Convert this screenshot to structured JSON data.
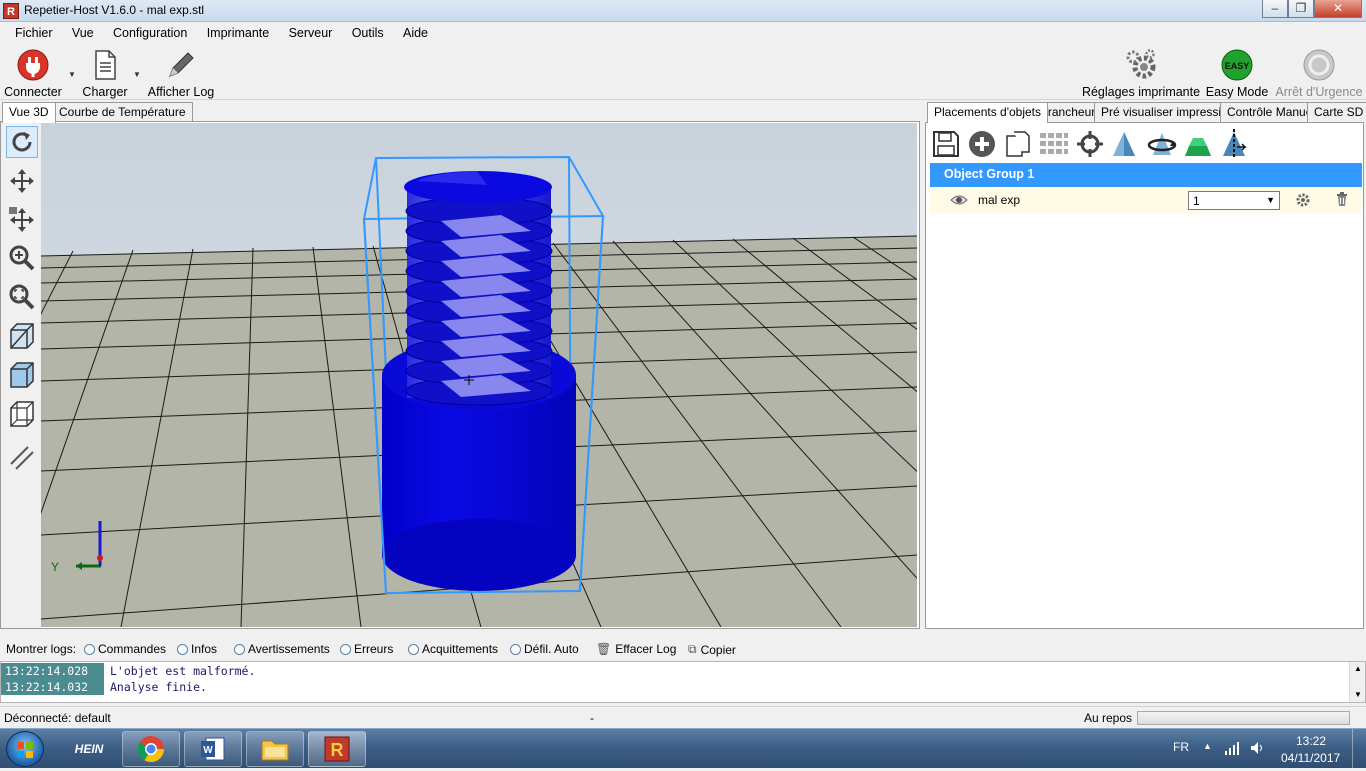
{
  "window": {
    "title": "Repetier-Host V1.6.0 - mal exp.stl",
    "app_icon": "R"
  },
  "menu": [
    "Fichier",
    "Vue",
    "Configuration",
    "Imprimante",
    "Serveur",
    "Outils",
    "Aide"
  ],
  "toolbar": {
    "connect": "Connecter",
    "load": "Charger",
    "show_log": "Afficher Log",
    "printer_settings": "Réglages imprimante",
    "easy_mode": "Easy Mode",
    "easy_badge": "EASY",
    "emergency": "Arrêt d'Urgence"
  },
  "view_tabs": [
    "Vue 3D",
    "Courbe de Température"
  ],
  "right_tabs": [
    "Placements d'objets",
    "Trancheur",
    "Pré visualiser impression",
    "Contrôle Manuel",
    "Carte SD"
  ],
  "objects": {
    "group": "Object Group 1",
    "item_name": "mal exp",
    "copies": "1"
  },
  "axis": {
    "y_label": "Y"
  },
  "log_bar": {
    "label": "Montrer logs:",
    "options": [
      "Commandes",
      "Infos",
      "Avertissements",
      "Erreurs",
      "Acquittements",
      "Défil. Auto"
    ],
    "clear": "Effacer Log",
    "copy": "Copier"
  },
  "log": [
    {
      "time": "13:22:14.028",
      "msg": "L'objet est malformé."
    },
    {
      "time": "13:22:14.032",
      "msg": "Analyse finie."
    }
  ],
  "status": {
    "left": "Déconnecté: default",
    "center": "-",
    "right": "Au repos"
  },
  "taskbar": {
    "lang": "FR",
    "time": "13:22",
    "date": "04/11/2017",
    "hein_label": "HEIN"
  },
  "colors": {
    "object": "#0a0ad8",
    "selection": "#3399ff",
    "floor": "#b3b5a8",
    "sky": "#d8dfe6"
  }
}
